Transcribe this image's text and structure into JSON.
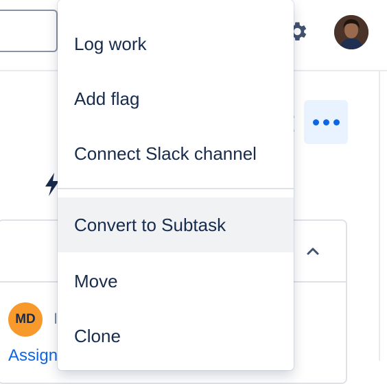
{
  "header": {
    "search": {
      "value": ""
    },
    "settings_icon": "gear-icon",
    "profile_avatar": "avatar-photo"
  },
  "issue": {
    "more_actions_icon": "more-horizontal-icon",
    "panel": {
      "collapse_icon": "chevron-up-icon",
      "assignee_initials": "MD",
      "assign_link": "Assign"
    }
  },
  "menu": {
    "items": [
      {
        "label": "Log work"
      },
      {
        "label": "Add flag"
      },
      {
        "label": "Connect Slack channel"
      },
      {
        "label": "Convert to Subtask",
        "state": "hovered"
      },
      {
        "label": "Move"
      },
      {
        "label": "Clone"
      }
    ]
  },
  "colors": {
    "accent": "#0c66e4",
    "accent_bg": "#e9f2ff",
    "text": "#172b4d",
    "hover_bg": "#f1f2f4",
    "assignee_avatar": "#f79a2b"
  }
}
